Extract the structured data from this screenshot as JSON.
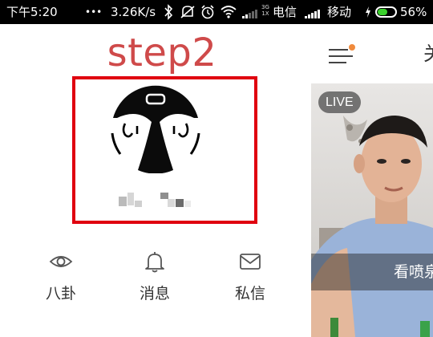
{
  "status_bar": {
    "time": "下午5:20",
    "dots": "•••",
    "speed": "3.26K/s",
    "network_tag_top": "3G",
    "network_tag_bottom": "1X",
    "carrier1": "电信",
    "carrier2": "移动",
    "battery_percent": "56%",
    "battery_level": 0.56,
    "icons": [
      "bluetooth-icon",
      "mute-icon",
      "alarm-icon",
      "wifi-icon",
      "signal-icon",
      "charging-icon",
      "battery-icon"
    ]
  },
  "drawer": {
    "step_label": "step2",
    "highlight_color": "#e0000f",
    "nav_items": [
      {
        "label": "八卦",
        "icon": "eye-icon"
      },
      {
        "label": "消息",
        "icon": "bell-icon"
      },
      {
        "label": "私信",
        "icon": "envelope-icon"
      }
    ]
  },
  "main": {
    "toolbar_text": "关",
    "live_badge": "LIVE",
    "card_caption": "看喷泉",
    "accent_color": "#f08a3c"
  }
}
